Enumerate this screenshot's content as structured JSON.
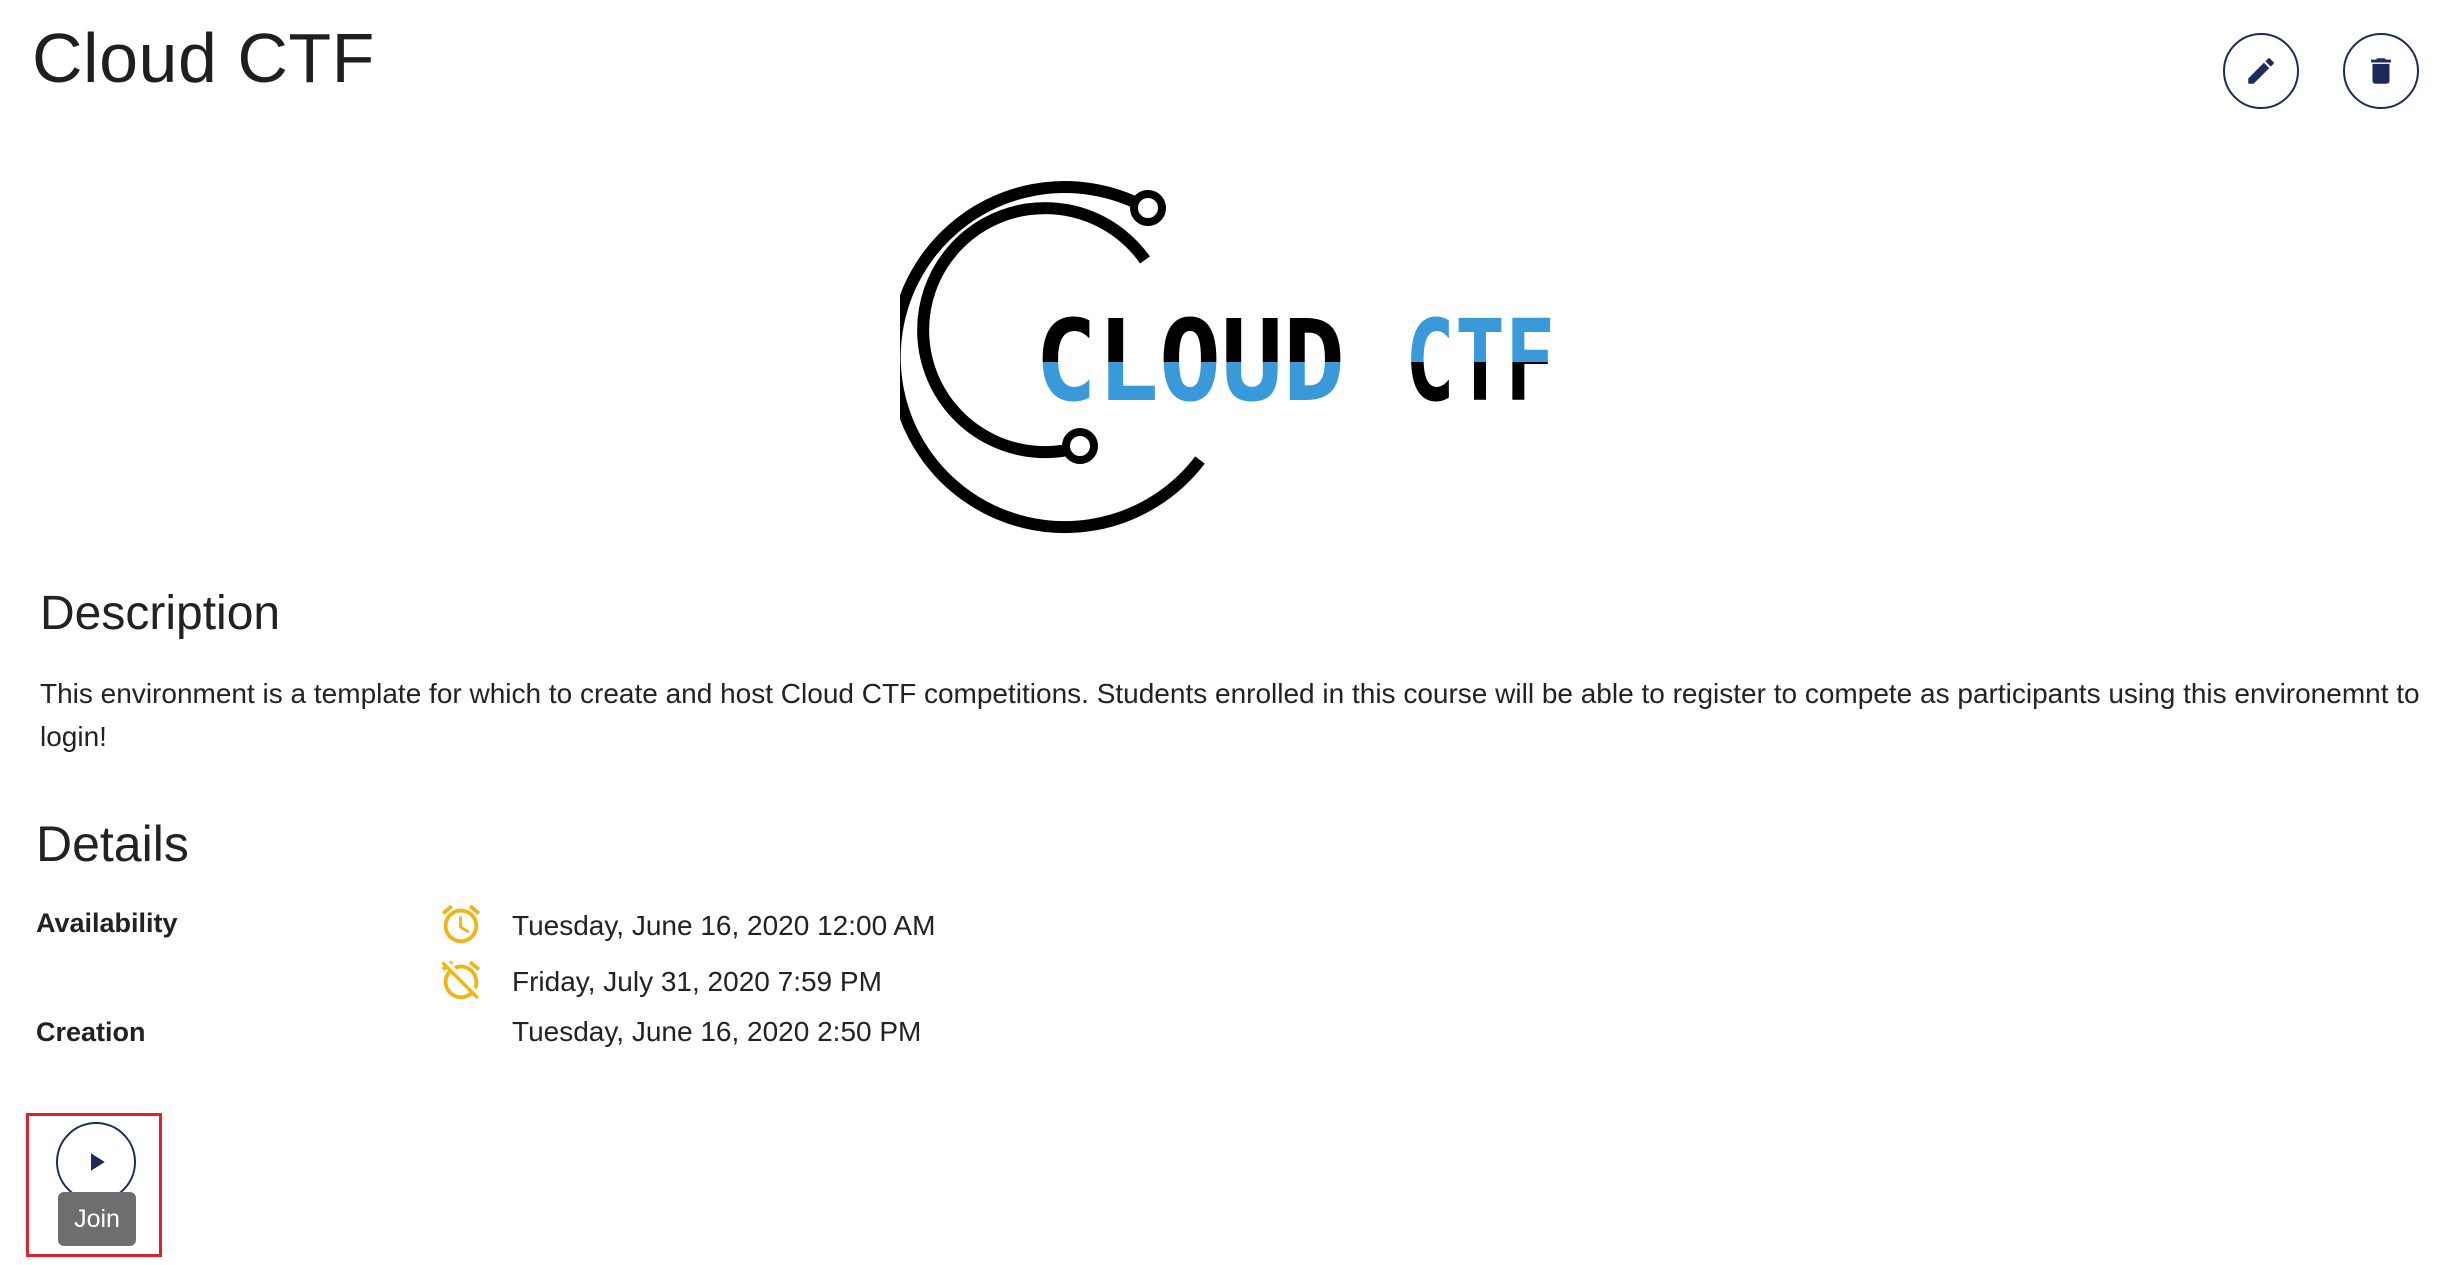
{
  "page": {
    "title": "Cloud CTF"
  },
  "toolbar": {
    "edit_icon": "pencil-icon",
    "delete_icon": "trash-icon"
  },
  "logo": {
    "text_part1": "CLOUD",
    "text_part2": "CTF",
    "accent_color": "#3a9ad9",
    "dark_color": "#000000"
  },
  "description": {
    "heading": "Description",
    "text": "This environment is a template for which to create and host Cloud CTF competitions. Students enrolled in this course will be able to register to compete as participants using this environemnt to login!"
  },
  "details": {
    "heading": "Details",
    "availability_label": "Availability",
    "availability_start": "Tuesday, June 16, 2020 12:00 AM",
    "availability_end": "Friday, July 31, 2020 7:59 PM",
    "creation_label": "Creation",
    "creation_value": "Tuesday, June 16, 2020 2:50 PM",
    "alarm_color": "#f2b415"
  },
  "join": {
    "icon": "play-icon",
    "tooltip": "Join"
  },
  "colors": {
    "button_border": "#1c2a5c",
    "highlight": "#e0202e",
    "tooltip_bg": "#6e6e6e"
  }
}
